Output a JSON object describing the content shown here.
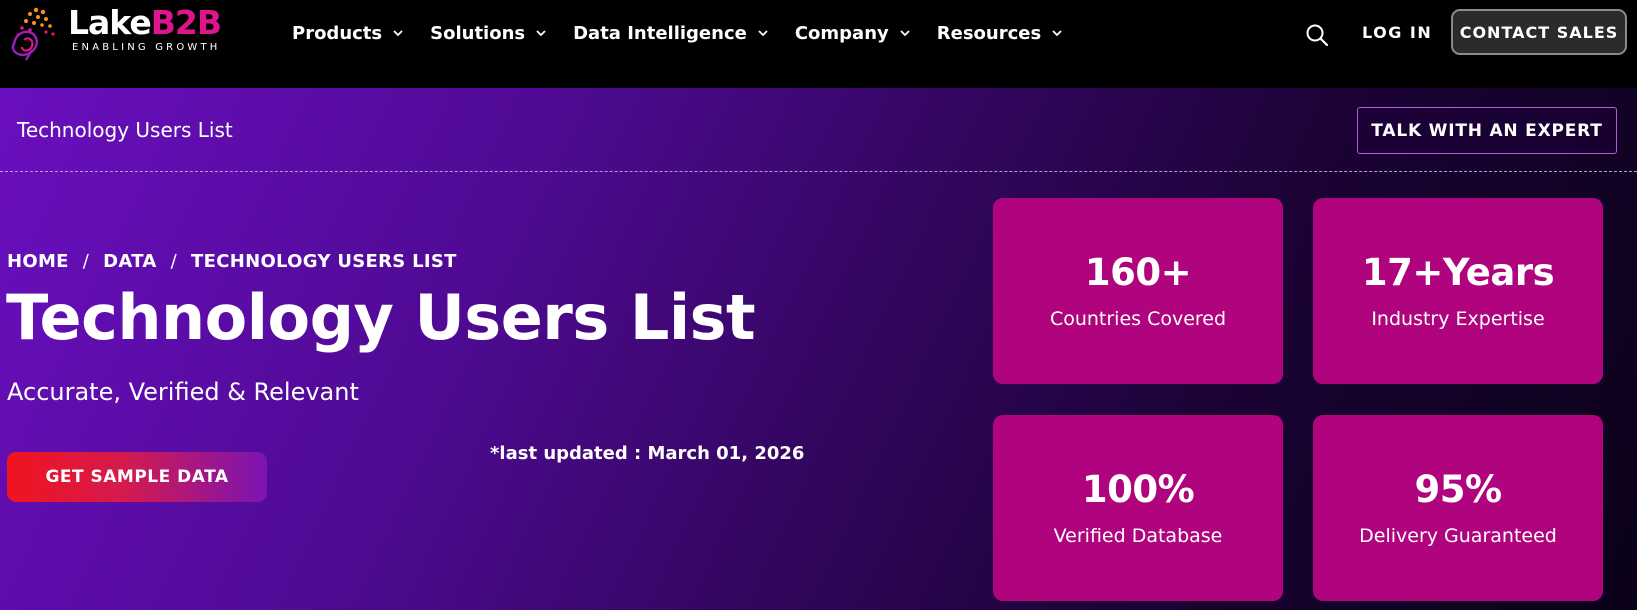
{
  "brand": {
    "name_part1": "Lake",
    "name_part2": "B2B",
    "tagline": "ENABLING GROWTH",
    "accent_color": "#e0148c"
  },
  "nav": {
    "items": [
      {
        "label": "Products",
        "icon": "chevron-down-icon"
      },
      {
        "label": "Solutions",
        "icon": "chevron-down-icon"
      },
      {
        "label": "Data Intelligence",
        "icon": "chevron-down-icon"
      },
      {
        "label": "Company",
        "icon": "chevron-down-icon"
      },
      {
        "label": "Resources",
        "icon": "chevron-down-icon"
      }
    ],
    "search_icon": "search-icon",
    "login_label": "LOG IN",
    "contact_label": "CONTACT SALES"
  },
  "subbar": {
    "title": "Technology Users List",
    "expert_label": "TALK WITH AN EXPERT"
  },
  "hero": {
    "breadcrumb": [
      "HOME",
      "DATA",
      "TECHNOLOGY USERS LIST"
    ],
    "breadcrumb_separator": "/",
    "title": "Technology Users List",
    "tagline": "Accurate, Verified & Relevant",
    "cta_label": "GET SAMPLE DATA",
    "last_updated": "*last updated : March 01, 2026"
  },
  "stats": [
    {
      "value": "160+",
      "label": "Countries Covered"
    },
    {
      "value": "17+Years",
      "label": "Industry Expertise"
    },
    {
      "value": "100%",
      "label": "Verified Database"
    },
    {
      "value": "95%",
      "label": "Delivery Guaranteed"
    }
  ],
  "colors": {
    "card": "#b0037e",
    "cta_start": "#f0141e",
    "cta_end": "#7a14b4",
    "hero_start": "#6a0fbf"
  }
}
